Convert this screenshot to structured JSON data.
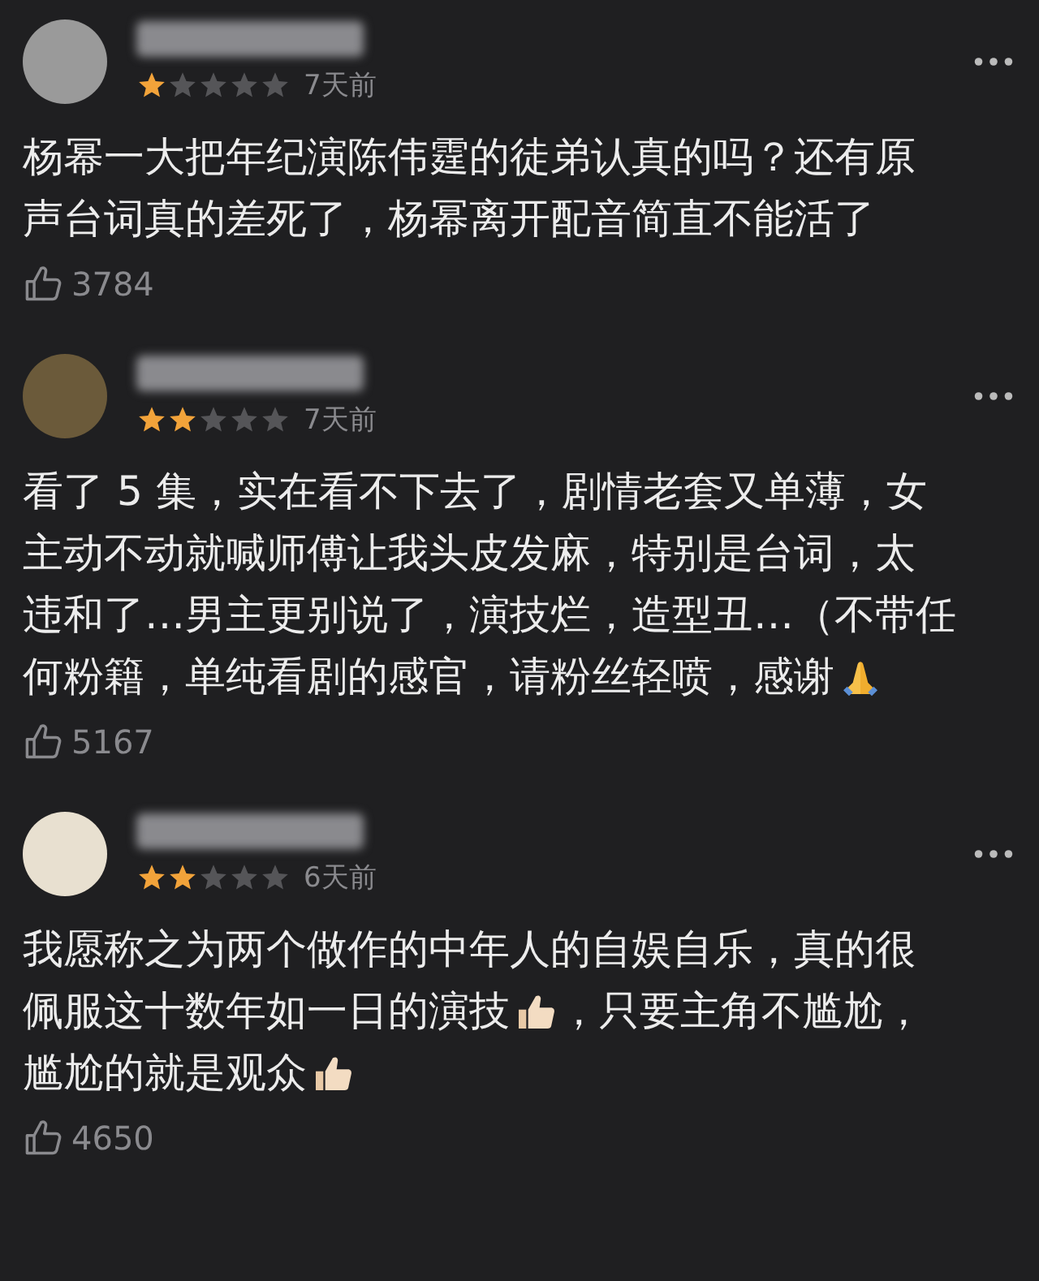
{
  "reviews": [
    {
      "stars": 1,
      "time": "7天前",
      "lines": [
        [
          {
            "kind": "text",
            "text": "杨幂一大把年纪演陈伟霆的徒弟认真的吗？还有原"
          }
        ],
        [
          {
            "kind": "text",
            "text": "声台词真的差死了，杨幂离开配音简直不能活了"
          }
        ]
      ],
      "likes": "3784"
    },
    {
      "stars": 2,
      "time": "7天前",
      "lines": [
        [
          {
            "kind": "text",
            "text": "看了 5 集，实在看不下去了，剧情老套又单薄，女"
          }
        ],
        [
          {
            "kind": "text",
            "text": "主动不动就喊师傅让我头皮发麻，特别是台词，太"
          }
        ],
        [
          {
            "kind": "text",
            "text": "违和了…男主更别说了，演技烂，造型丑…（不带任"
          }
        ],
        [
          {
            "kind": "text",
            "text": "何粉籍，单纯看剧的感官，请粉丝轻喷，感谢"
          },
          {
            "kind": "pray"
          }
        ]
      ],
      "likes": "5167"
    },
    {
      "stars": 2,
      "time": "6天前",
      "lines": [
        [
          {
            "kind": "text",
            "text": "我愿称之为两个做作的中年人的自娱自乐，真的很"
          }
        ],
        [
          {
            "kind": "text",
            "text": "佩服这十数年如一日的演技"
          },
          {
            "kind": "thumb"
          },
          {
            "kind": "text",
            "text": "，只要主角不尴尬，"
          }
        ],
        [
          {
            "kind": "text",
            "text": "尴尬的就是观众"
          },
          {
            "kind": "thumb"
          }
        ]
      ],
      "likes": "4650"
    }
  ]
}
